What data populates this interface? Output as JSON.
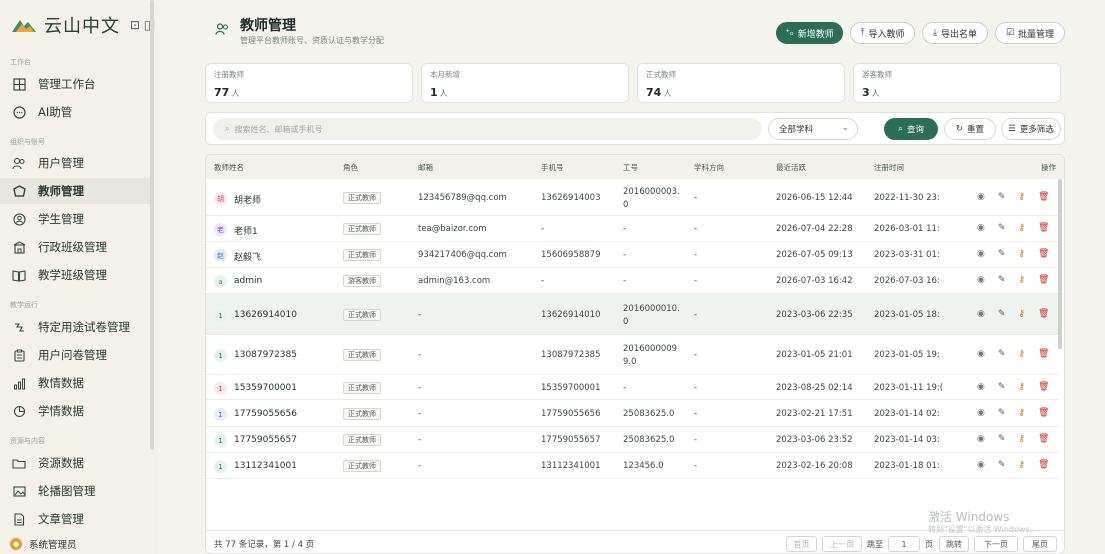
{
  "sidebar": {
    "logo_text": "云山中文",
    "groups": [
      "工作台",
      "组织与账号",
      "教学运行",
      "资源与内容"
    ],
    "items": [
      {
        "label": "管理工作台",
        "icon": "grid-icon"
      },
      {
        "label": "AI助管",
        "icon": "chat-bubble-icon"
      },
      {
        "label": "用户管理",
        "icon": "users-icon"
      },
      {
        "label": "教师管理",
        "icon": "shield-icon"
      },
      {
        "label": "学生管理",
        "icon": "student-icon"
      },
      {
        "label": "行政班级管理",
        "icon": "building-icon"
      },
      {
        "label": "教学班级管理",
        "icon": "book-icon"
      },
      {
        "label": "特定用途试卷管理",
        "icon": "route-icon"
      },
      {
        "label": "用户问卷管理",
        "icon": "clipboard-icon"
      },
      {
        "label": "教情数据",
        "icon": "bar-chart-icon"
      },
      {
        "label": "学情数据",
        "icon": "pie-chart-icon"
      },
      {
        "label": "资源数据",
        "icon": "folder-icon"
      },
      {
        "label": "轮播图管理",
        "icon": "image-icon"
      },
      {
        "label": "文章管理",
        "icon": "document-icon"
      }
    ],
    "active": "教师管理",
    "user": {
      "name": "系统管理员"
    }
  },
  "header": {
    "title": "教师管理",
    "subtitle": "管理平台教师账号、资质认证与教学分配",
    "buttons": {
      "add": "新增教师",
      "import": "导入教师",
      "export": "导出名单",
      "batch": "批量管理"
    }
  },
  "stats": [
    {
      "label": "注册教师",
      "value": "77",
      "unit": "人"
    },
    {
      "label": "本月新增",
      "value": "1",
      "unit": "人"
    },
    {
      "label": "正式教师",
      "value": "74",
      "unit": "人"
    },
    {
      "label": "游客教师",
      "value": "3",
      "unit": "人"
    }
  ],
  "filter": {
    "search_placeholder": "搜索姓名、邮箱或手机号",
    "subject": "全部学科",
    "query": "查询",
    "reset": "重置",
    "more": "更多筛选"
  },
  "table": {
    "headers": [
      "教师姓名",
      "角色",
      "邮箱",
      "手机号",
      "工号",
      "学科方向",
      "最近活跃",
      "注册时间",
      "操作"
    ],
    "rows": [
      {
        "avatar": "胡",
        "name": "胡老师",
        "role": "正式教师",
        "email": "123456789@qq.com",
        "phone": "13626914003",
        "id1": "2016000003.",
        "id2": "0",
        "subject": "-",
        "active": "2026-06-15 12:44",
        "registered": "2022-11-30 23:"
      },
      {
        "avatar": "老",
        "name": "老师1",
        "role": "正式教师",
        "email": "tea@baizor.com",
        "phone": "-",
        "id1": "-",
        "id2": "",
        "subject": "-",
        "active": "2026-07-04 22:28",
        "registered": "2026-03-01 11:"
      },
      {
        "avatar": "赵",
        "name": "赵毅飞",
        "role": "正式教师",
        "email": "934217406@qq.com",
        "phone": "15606958879",
        "id1": "-",
        "id2": "",
        "subject": "-",
        "active": "2026-07-05 09:13",
        "registered": "2023-03-31 01:"
      },
      {
        "avatar": "a",
        "name": "admin",
        "role": "游客教师",
        "email": "admin@163.com",
        "phone": "-",
        "id1": "-",
        "id2": "",
        "subject": "-",
        "active": "2026-07-03 16:42",
        "registered": "2026-07-03 16:"
      },
      {
        "avatar": "1",
        "name": "13626914010",
        "role": "正式教师",
        "email": "-",
        "phone": "13626914010",
        "id1": "2016000010.",
        "id2": "0",
        "subject": "-",
        "active": "2023-03-06 22:35",
        "registered": "2023-01-05 18:"
      },
      {
        "avatar": "1",
        "name": "13087972385",
        "role": "正式教师",
        "email": "-",
        "phone": "13087972385",
        "id1": "2016000009",
        "id2": "9.0",
        "subject": "-",
        "active": "2023-01-05 21:01",
        "registered": "2023-01-05 19:"
      },
      {
        "avatar": "1",
        "name": "15359700001",
        "role": "正式教师",
        "email": "-",
        "phone": "15359700001",
        "id1": "-",
        "id2": "",
        "subject": "-",
        "active": "2023-08-25 02:14",
        "registered": "2023-01-11 19:("
      },
      {
        "avatar": "1",
        "name": "17759055656",
        "role": "正式教师",
        "email": "-",
        "phone": "17759055656",
        "id1": "25083625.0",
        "id2": "",
        "subject": "-",
        "active": "2023-02-21 17:51",
        "registered": "2023-01-14 02:"
      },
      {
        "avatar": "1",
        "name": "17759055657",
        "role": "正式教师",
        "email": "-",
        "phone": "17759055657",
        "id1": "25083625.0",
        "id2": "",
        "subject": "-",
        "active": "2023-03-06 23:52",
        "registered": "2023-01-14 03:"
      },
      {
        "avatar": "1",
        "name": "13112341001",
        "role": "正式教师",
        "email": "-",
        "phone": "13112341001",
        "id1": "123456.0",
        "id2": "",
        "subject": "-",
        "active": "2023-02-16 20:08",
        "registered": "2023-01-18 01:"
      }
    ]
  },
  "pagination": {
    "info": "共 77 条记录，第 1 / 4 页",
    "first": "首页",
    "prev": "上一页",
    "goto": "跳至",
    "page_input": "1",
    "page_unit": "页",
    "jump": "跳转",
    "next": "下一页",
    "last": "尾页"
  },
  "watermark": {
    "line1": "激活 Windows",
    "line2": "转到\"设置\"以激活 Windows。"
  },
  "colors": {
    "accent": "#2b6e55",
    "danger": "#c9342c",
    "key": "#d4761d"
  }
}
